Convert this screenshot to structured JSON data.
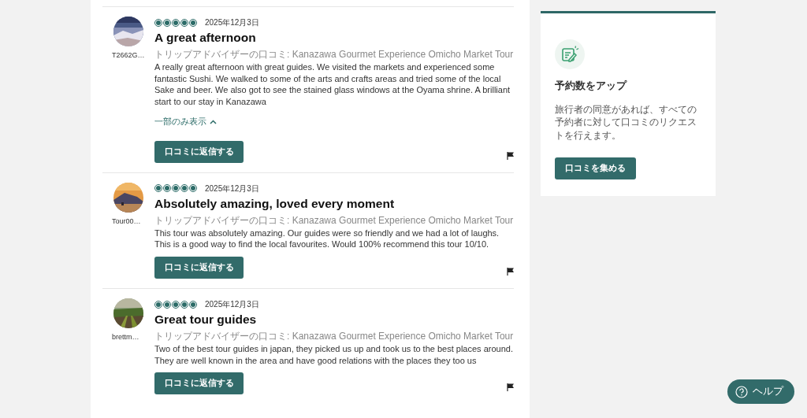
{
  "reviews": [
    {
      "user": "T2662G…",
      "stars": 5,
      "date": "2025年12月3日",
      "title": "A great afternoon",
      "source": "トリップアドバイザーの口コミ: Kanazawa Gourmet Experience Omicho Market Tour",
      "body": "A really great afternoon with great guides. We visited the markets and experienced some fantastic Sushi. We walked to some of the arts and crafts areas and tried some of the local Sake and beer. We also got to see the stained glass windows at the Oyama shrine. A brilliant start to our stay in Kanazawa",
      "toggle": {
        "label": "一部のみ表示",
        "expanded": true
      },
      "reply_button": "口コミに返信する"
    },
    {
      "user": "Tour00…",
      "stars": 5,
      "date": "2025年12月3日",
      "title": "Absolutely amazing, loved every moment",
      "source": "トリップアドバイザーの口コミ: Kanazawa Gourmet Experience Omicho Market Tour",
      "body": "This tour was absolutely amazing. Our guides were so friendly and we had a lot of laughs. This is a good way to find the local favourites. Would 100% recommend this tour 10/10.",
      "reply_button": "口コミに返信する"
    },
    {
      "user": "brettm…",
      "stars": 5,
      "date": "2025年12月3日",
      "title": "Great tour guides",
      "source": "トリップアドバイザーの口コミ: Kanazawa Gourmet Experience Omicho Market Tour",
      "body": "Two of the best tour guides in japan, they picked us up and took us to the best places around. They are well known in the area and have good relations with the places they too us",
      "reply_button": "口コミに返信する"
    }
  ],
  "promo": {
    "title": "予約数をアップ",
    "text": "旅行者の同意があれば、すべての予約者に対して口コミのリクエストを行えます。",
    "button": "口コミを集める"
  },
  "help_button": "ヘルプ"
}
